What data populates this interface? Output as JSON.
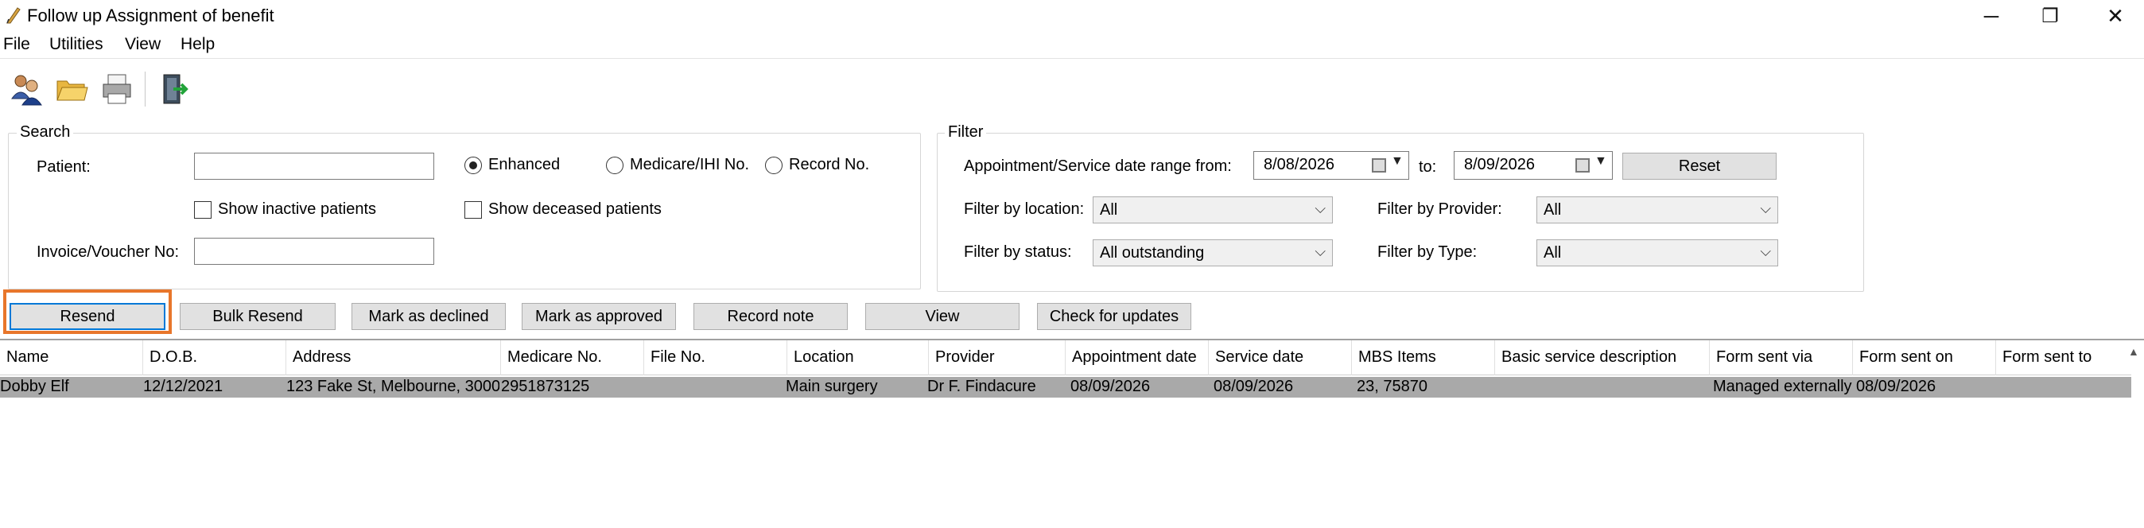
{
  "window": {
    "title": "Follow up Assignment of benefit",
    "minimize": "─",
    "maximize": "❐",
    "close": "✕"
  },
  "menu": [
    "File",
    "Utilities",
    "View",
    "Help"
  ],
  "toolbar_icons": [
    "patients-icon",
    "open-folder-icon",
    "print-icon",
    "exit-door-icon"
  ],
  "search": {
    "title": "Search",
    "patient_label": "Patient:",
    "patient_value": "",
    "radios": [
      {
        "label": "Enhanced",
        "selected": true
      },
      {
        "label": "Medicare/IHI No.",
        "selected": false
      },
      {
        "label": "Record No.",
        "selected": false
      }
    ],
    "show_inactive": "Show inactive patients",
    "show_deceased": "Show deceased patients",
    "invoice_label": "Invoice/Voucher No:",
    "invoice_value": ""
  },
  "filter": {
    "title": "Filter",
    "range_label": "Appointment/Service date range from:",
    "from_date": "8/08/2026",
    "to_label": "to:",
    "to_date": "8/09/2026",
    "reset": "Reset",
    "location_label": "Filter by location:",
    "location_value": "All",
    "provider_label": "Filter by Provider:",
    "provider_value": "All",
    "status_label": "Filter by status:",
    "status_value": "All outstanding",
    "type_label": "Filter by Type:",
    "type_value": "All"
  },
  "actions": {
    "resend": "Resend",
    "bulk_resend": "Bulk Resend",
    "mark_declined": "Mark as declined",
    "mark_approved": "Mark as approved",
    "record_note": "Record note",
    "view": "View",
    "check_updates": "Check for updates"
  },
  "grid": {
    "columns": [
      "Name",
      "D.O.B.",
      "Address",
      "Medicare No.",
      "File No.",
      "Location",
      "Provider",
      "Appointment date",
      "Service date",
      "MBS Items",
      "Basic service description",
      "Form sent via",
      "Form sent on",
      "Form sent to"
    ],
    "rows": [
      [
        "Dobby Elf",
        "12/12/2021",
        "123 Fake St, Melbourne, 3000.",
        "2951873125",
        "",
        "Main surgery",
        "Dr F. Findacure",
        "08/09/2026",
        "08/09/2026",
        "23, 75870",
        "",
        "Managed externally",
        "08/09/2026",
        ""
      ]
    ]
  },
  "colors": {
    "highlight": "#e8762b",
    "selected_row": "#a9a9a9",
    "focus": "#0078d7"
  }
}
